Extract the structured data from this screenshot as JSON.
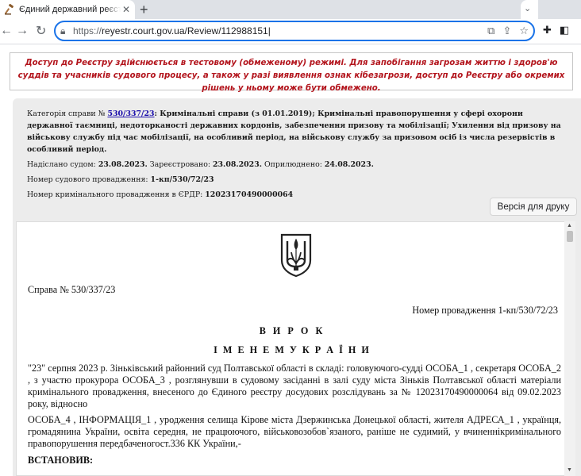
{
  "browser": {
    "tab_title": "Єдиний державний реєстр судових рішень",
    "url_scheme": "https://",
    "url_host": "reyestr.court.gov.ua",
    "url_path": "/Review/112988151"
  },
  "warning": {
    "text": "Доступ до Реєстру здійснюється в тестовому (обмеженому) режимі. Для запобігання загрозам життю і здоров'ю суддів та учасників судового процесу, а також у разі виявлення ознак кібезагрози, доступ до Реєстру або окремих рішень у ньому може бути обмежено."
  },
  "meta": {
    "category_label": "Категорія справи №",
    "case_link": "530/337/23",
    "category_text": ": Кримінальні справи (з 01.01.2019); Кримінальні правопорушення у сфері охорони державної таємниці, недоторканості державних кордонів, забезпечення призову та мобілізації; Ухилення від призову на військову службу під час мобілізації, на особливий період, на військову службу за призовом осіб із числа резервістів в особливий період.",
    "sent_label": "Надіслано судом:",
    "sent_date": "23.08.2023.",
    "registered_label": "Зареєстровано:",
    "registered_date": "23.08.2023.",
    "published_label": "Оприлюднено:",
    "published_date": "24.08.2023.",
    "proceeding_label": "Номер судового провадження:",
    "proceeding_no": "1-кп/530/72/23",
    "erdr_label": "Номер кримінального провадження в ЄРДР:",
    "erdr_no": "12023170490000064"
  },
  "print_button": "Версія для друку",
  "document": {
    "case_no": "Справа № 530/337/23",
    "proceeding": "Номер провадження 1-кп/530/72/23",
    "verdict": "В И Р О К",
    "in_name": "І М Е Н Е М У К Р А Ї Н И",
    "para1": "\"23\" серпня 2023 р. Зіньківський районний суд Полтавської області в складі: головуючого-судді ОСОБА_1 , секретаря ОСОБА_2 , з участю прокурора ОСОБА_3 , розглянувши в судовому засіданні в залі суду міста Зіньків Полтавської області матеріали кримінального провадження, внесеного до Єдиного реєстру досудових розслідувань за № 12023170490000064 від 09.02.2023 року, відносно",
    "para2": "ОСОБА_4 , ІНФОРМАЦІЯ_1 , уродження селища Кірове міста Дзержинська Донецької області, жителя АДРЕСА_1 , українця, громадянина України, освіта середня, не працюючого, військовозобов`язаного, раніше не судимий, у вчиненнікримінального правопорушення передбаченогост.336 КК України,-",
    "established": "ВСТАНОВИВ:"
  }
}
